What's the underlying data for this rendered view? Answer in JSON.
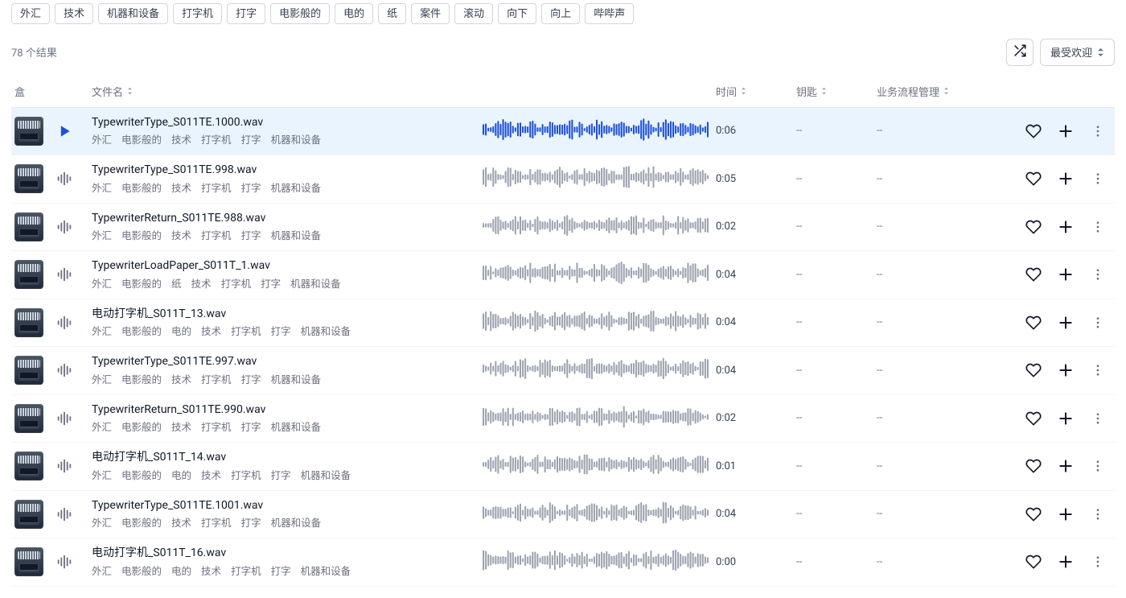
{
  "tags": [
    "外汇",
    "技术",
    "机器和设备",
    "打字机",
    "打字",
    "电影般的",
    "电的",
    "纸",
    "案件",
    "滚动",
    "向下",
    "向上",
    "哔哔声"
  ],
  "result_count_text": "78 个结果",
  "sort_label": "最受欢迎",
  "columns": {
    "box": "盒",
    "filename": "文件名",
    "time": "时间",
    "key": "钥匙",
    "bpm": "业务流程管理"
  },
  "waveform_color_active": "#1d4ed8",
  "waveform_color": "#9ca3af",
  "rows": [
    {
      "filename": "TypewriterType_S011TE.1000.wav",
      "tags": [
        "外汇",
        "电影般的",
        "技术",
        "打字机",
        "打字",
        "机器和设备"
      ],
      "duration": "0:06",
      "key": "--",
      "bpm": "--",
      "active": true
    },
    {
      "filename": "TypewriterType_S011TE.998.wav",
      "tags": [
        "外汇",
        "电影般的",
        "技术",
        "打字机",
        "打字",
        "机器和设备"
      ],
      "duration": "0:05",
      "key": "--",
      "bpm": "--",
      "active": false
    },
    {
      "filename": "TypewriterReturn_S011TE.988.wav",
      "tags": [
        "外汇",
        "电影般的",
        "技术",
        "打字机",
        "打字",
        "机器和设备"
      ],
      "duration": "0:02",
      "key": "--",
      "bpm": "--",
      "active": false
    },
    {
      "filename": "TypewriterLoadPaper_S011T_1.wav",
      "tags": [
        "外汇",
        "电影般的",
        "纸",
        "技术",
        "打字机",
        "打字",
        "机器和设备"
      ],
      "duration": "0:04",
      "key": "--",
      "bpm": "--",
      "active": false
    },
    {
      "filename": "电动打字机_S011T_13.wav",
      "tags": [
        "外汇",
        "电影般的",
        "电的",
        "技术",
        "打字机",
        "打字",
        "机器和设备"
      ],
      "duration": "0:04",
      "key": "--",
      "bpm": "--",
      "active": false
    },
    {
      "filename": "TypewriterType_S011TE.997.wav",
      "tags": [
        "外汇",
        "电影般的",
        "技术",
        "打字机",
        "打字",
        "机器和设备"
      ],
      "duration": "0:04",
      "key": "--",
      "bpm": "--",
      "active": false
    },
    {
      "filename": "TypewriterReturn_S011TE.990.wav",
      "tags": [
        "外汇",
        "电影般的",
        "技术",
        "打字机",
        "打字",
        "机器和设备"
      ],
      "duration": "0:02",
      "key": "--",
      "bpm": "--",
      "active": false
    },
    {
      "filename": "电动打字机_S011T_14.wav",
      "tags": [
        "外汇",
        "电影般的",
        "电的",
        "技术",
        "打字机",
        "打字",
        "机器和设备"
      ],
      "duration": "0:01",
      "key": "--",
      "bpm": "--",
      "active": false
    },
    {
      "filename": "TypewriterType_S011TE.1001.wav",
      "tags": [
        "外汇",
        "电影般的",
        "技术",
        "打字机",
        "打字",
        "机器和设备"
      ],
      "duration": "0:04",
      "key": "--",
      "bpm": "--",
      "active": false
    },
    {
      "filename": "电动打字机_S011T_16.wav",
      "tags": [
        "外汇",
        "电影般的",
        "电的",
        "技术",
        "打字机",
        "打字",
        "机器和设备"
      ],
      "duration": "0:00",
      "key": "--",
      "bpm": "--",
      "active": false
    }
  ]
}
